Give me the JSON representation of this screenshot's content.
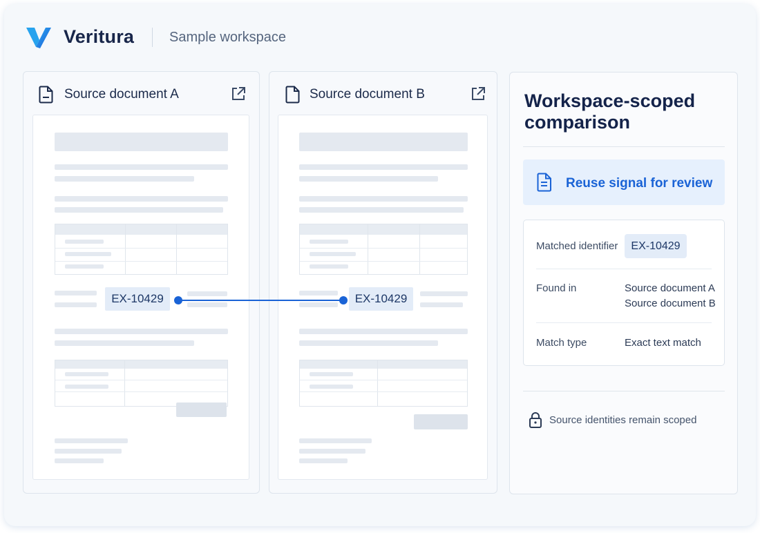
{
  "app": {
    "name": "Veritura",
    "workspace": "Sample workspace",
    "accent_color": "#1a63d6",
    "logo_icon": "veritura-v-logo"
  },
  "documents": [
    {
      "title": "Source document A",
      "icon": "document-icon",
      "action_icon": "open-external-icon",
      "identifier": "EX-10429"
    },
    {
      "title": "Source document B",
      "icon": "document-icon",
      "action_icon": "open-external-icon",
      "identifier": "EX-10429"
    }
  ],
  "comparison": {
    "title": "Workspace-scoped comparison",
    "signal": {
      "icon": "document-icon",
      "label": "Reuse signal for review"
    },
    "details": {
      "matched_identifier_label": "Matched identifier",
      "matched_identifier_value": "EX-10429",
      "found_in_label": "Found in",
      "found_in_values": [
        "Source document A",
        "Source document B"
      ],
      "match_type_label": "Match type",
      "match_type_value": "Exact text match"
    },
    "footer": {
      "icon": "lock-icon",
      "text": "Source identities remain scoped"
    }
  }
}
